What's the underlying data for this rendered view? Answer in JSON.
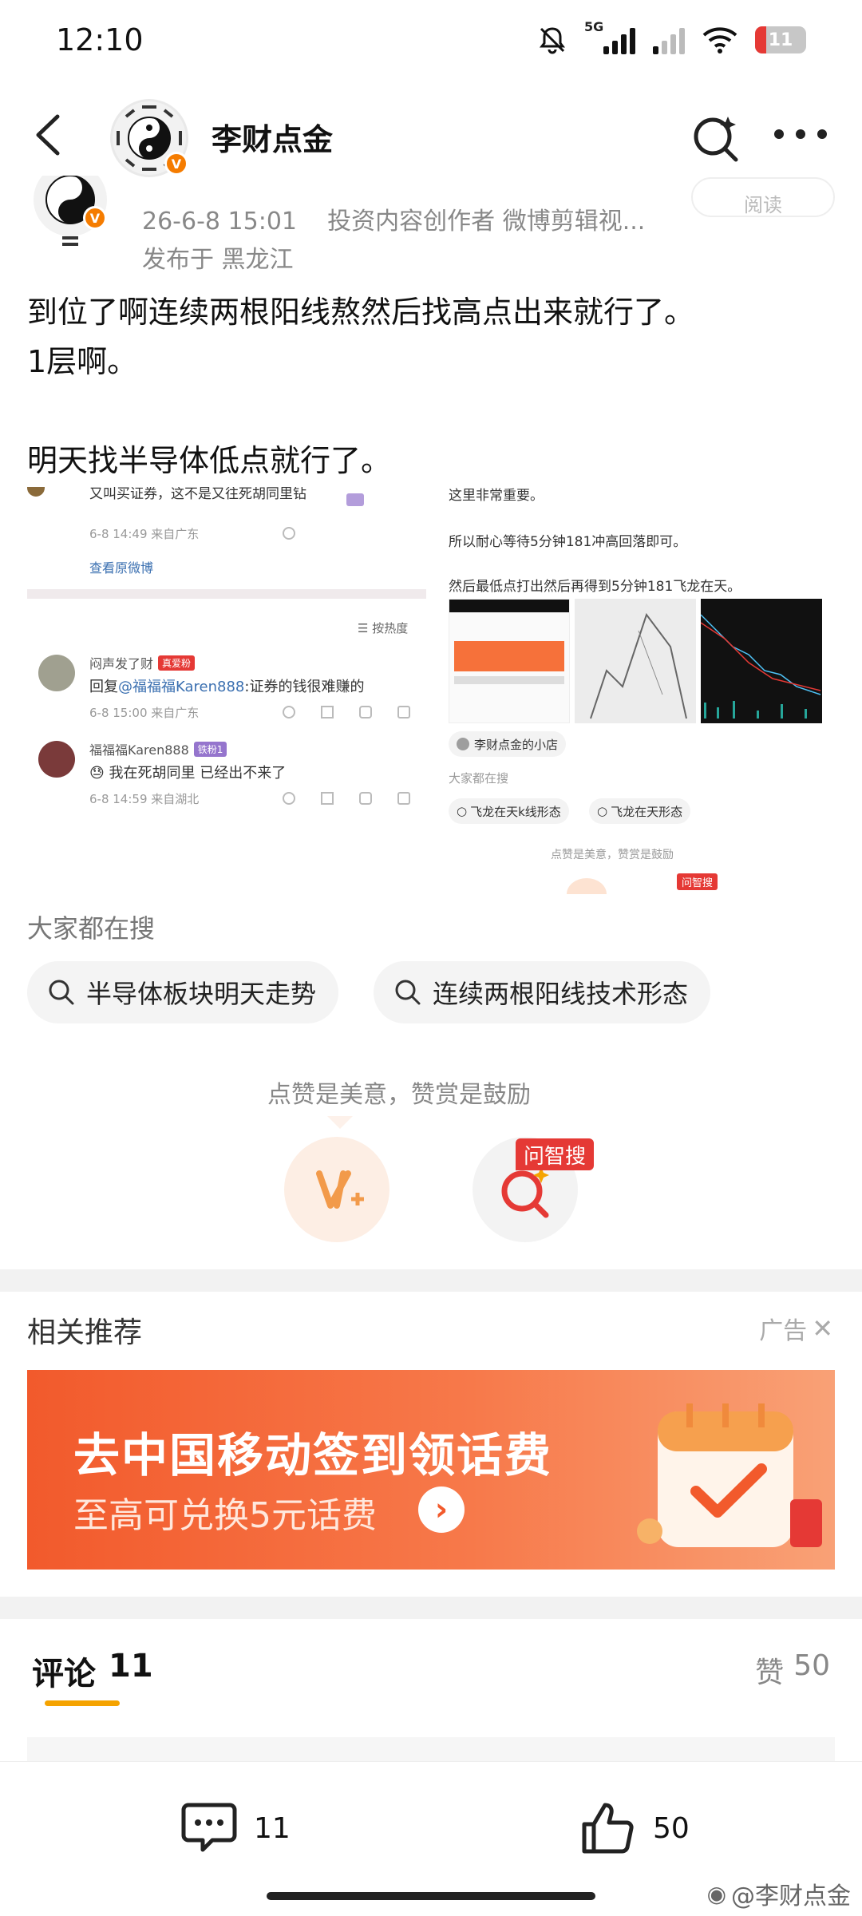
{
  "status_bar": {
    "time": "12:10",
    "network": "5G",
    "battery": "11"
  },
  "header": {
    "title": "李财点金",
    "verified_badge": "V"
  },
  "post": {
    "timestamp": "26-6-8 15:01",
    "author_tags": "投资内容创作者 微博剪辑视...",
    "location": "发布于 黑龙江",
    "read_label": "阅读",
    "paragraphs": [
      "到位了啊连续两根阳线熬然后找高点出来就行了。",
      "1层啊。",
      "",
      "明天找半导体低点就行了。"
    ]
  },
  "collage": {
    "left": {
      "top_comment_text": "又叫买证券，这不是又往死胡同里钻",
      "top_comment_meta": "6-8 14:49  来自广东",
      "view_original": "查看原微博",
      "sort_label": "按热度",
      "comments": [
        {
          "user": "闷声发了财",
          "badge": "真爱粉",
          "reply_prefix": "回复",
          "mention": "@福福福Karen888",
          "text": ":证券的钱很难赚的",
          "meta": "6-8 15:00  来自广东"
        },
        {
          "user": "福福福Karen888",
          "badge": "铁粉1",
          "reply_prefix": "",
          "mention": "",
          "text": "我在死胡同里 已经出不来了",
          "meta": "6-8 14:59  来自湖北"
        }
      ]
    },
    "right": {
      "line1": "这里非常重要。",
      "line2": "所以耐心等待5分钟181冲高回落即可。",
      "line3": "然后最低点打出然后再得到5分钟181飞龙在天。",
      "shop": "李财点金的小店",
      "search_title": "大家都在搜",
      "chips": [
        "飞龙在天k线形态",
        "飞龙在天形态"
      ],
      "like_hint": "点赞是美意，赞赏是鼓励",
      "wzs": "问智搜"
    }
  },
  "hot_search": {
    "title": "大家都在搜",
    "chips": [
      "半导体板块明天走势",
      "连续两根阳线技术形态"
    ]
  },
  "appreciation": {
    "hint": "点赞是美意，赞赏是鼓励",
    "wzs_badge": "问智搜"
  },
  "recommend": {
    "title": "相关推荐",
    "ad_label": "广告"
  },
  "banner": {
    "headline": "去中国移动签到领话费",
    "subline": "至高可兑换5元话费"
  },
  "tabs": {
    "comments_label": "评论",
    "comments_count": "11",
    "likes_label": "赞",
    "likes_count": "50"
  },
  "bottom_bar": {
    "comment_count": "11",
    "like_count": "50"
  },
  "watermark": "@李财点金"
}
